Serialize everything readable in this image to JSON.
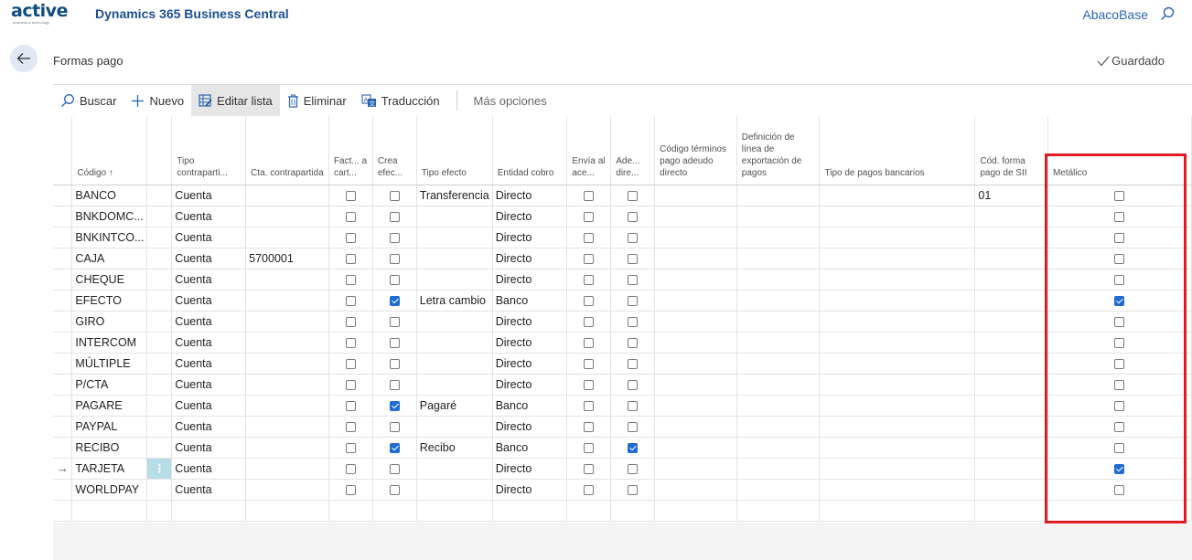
{
  "app": {
    "logo_text": "active",
    "logo_tagline": "business & technology",
    "title": "Dynamics 365 Business Central",
    "company": "AbacoBase"
  },
  "page": {
    "title": "Formas pago",
    "saved_label": "Guardado"
  },
  "actions": [
    {
      "label": "Buscar",
      "icon": "search-icon"
    },
    {
      "label": "Nuevo",
      "icon": "plus-icon"
    },
    {
      "label": "Editar lista",
      "icon": "edit-list-icon",
      "active": true
    },
    {
      "label": "Eliminar",
      "icon": "trash-icon"
    },
    {
      "label": "Traducción",
      "icon": "translate-icon"
    },
    {
      "label": "Más opciones"
    }
  ],
  "columns": {
    "codigo": "Código ↑",
    "tipo_contrapartida": "Tipo contraparti...",
    "cta_contrapartida": "Cta. contrapartida",
    "fact_cartera": "Fact... a cart...",
    "crea_efectos": "Crea efec...",
    "tipo_efecto": "Tipo efecto",
    "entidad_cobro": "Entidad cobro",
    "envia_aceptacion": "Envía al ace...",
    "adeudo_directo": "Ade... dire...",
    "codigo_terminos": "Código términos pago adeudo directo",
    "definicion_linea": "Definición de línea de exportación de pagos",
    "tipo_pagos_bancarios": "Tipo de pagos bancarios",
    "cod_forma_sii": "Cód. forma pago de SII",
    "metalico": "Metálico"
  },
  "rows": [
    {
      "codigo": "BANCO",
      "tipo": "Cuenta",
      "cta": "",
      "fact": false,
      "crea": false,
      "tipo_efecto": "Transferencia",
      "entidad": "Directo",
      "envia": false,
      "adeudo": false,
      "sii": "01",
      "metalico": false
    },
    {
      "codigo": "BNKDOMC...",
      "tipo": "Cuenta",
      "cta": "",
      "fact": false,
      "crea": false,
      "tipo_efecto": "",
      "entidad": "Directo",
      "envia": false,
      "adeudo": false,
      "sii": "",
      "metalico": false
    },
    {
      "codigo": "BNKINTCO...",
      "tipo": "Cuenta",
      "cta": "",
      "fact": false,
      "crea": false,
      "tipo_efecto": "",
      "entidad": "Directo",
      "envia": false,
      "adeudo": false,
      "sii": "",
      "metalico": false
    },
    {
      "codigo": "CAJA",
      "tipo": "Cuenta",
      "cta": "5700001",
      "fact": false,
      "crea": false,
      "tipo_efecto": "",
      "entidad": "Directo",
      "envia": false,
      "adeudo": false,
      "sii": "",
      "metalico": false
    },
    {
      "codigo": "CHEQUE",
      "tipo": "Cuenta",
      "cta": "",
      "fact": false,
      "crea": false,
      "tipo_efecto": "",
      "entidad": "Directo",
      "envia": false,
      "adeudo": false,
      "sii": "",
      "metalico": false
    },
    {
      "codigo": "EFECTO",
      "tipo": "Cuenta",
      "cta": "",
      "fact": false,
      "crea": true,
      "tipo_efecto": "Letra cambio",
      "entidad": "Banco",
      "envia": false,
      "adeudo": false,
      "sii": "",
      "metalico": true
    },
    {
      "codigo": "GIRO",
      "tipo": "Cuenta",
      "cta": "",
      "fact": false,
      "crea": false,
      "tipo_efecto": "",
      "entidad": "Directo",
      "envia": false,
      "adeudo": false,
      "sii": "",
      "metalico": false
    },
    {
      "codigo": "INTERCOM",
      "tipo": "Cuenta",
      "cta": "",
      "fact": false,
      "crea": false,
      "tipo_efecto": "",
      "entidad": "Directo",
      "envia": false,
      "adeudo": false,
      "sii": "",
      "metalico": false
    },
    {
      "codigo": "MÚLTIPLE",
      "tipo": "Cuenta",
      "cta": "",
      "fact": false,
      "crea": false,
      "tipo_efecto": "",
      "entidad": "Directo",
      "envia": false,
      "adeudo": false,
      "sii": "",
      "metalico": false
    },
    {
      "codigo": "P/CTA",
      "tipo": "Cuenta",
      "cta": "",
      "fact": false,
      "crea": false,
      "tipo_efecto": "",
      "entidad": "Directo",
      "envia": false,
      "adeudo": false,
      "sii": "",
      "metalico": false
    },
    {
      "codigo": "PAGARE",
      "tipo": "Cuenta",
      "cta": "",
      "fact": false,
      "crea": true,
      "tipo_efecto": "Pagaré",
      "entidad": "Banco",
      "envia": false,
      "adeudo": false,
      "sii": "",
      "metalico": false
    },
    {
      "codigo": "PAYPAL",
      "tipo": "Cuenta",
      "cta": "",
      "fact": false,
      "crea": false,
      "tipo_efecto": "",
      "entidad": "Directo",
      "envia": false,
      "adeudo": false,
      "sii": "",
      "metalico": false
    },
    {
      "codigo": "RECIBO",
      "tipo": "Cuenta",
      "cta": "",
      "fact": false,
      "crea": true,
      "tipo_efecto": "Recibo",
      "entidad": "Banco",
      "envia": false,
      "adeudo": true,
      "sii": "",
      "metalico": false
    },
    {
      "codigo": "TARJETA",
      "tipo": "Cuenta",
      "cta": "",
      "fact": false,
      "crea": false,
      "tipo_efecto": "",
      "entidad": "Directo",
      "envia": false,
      "adeudo": false,
      "sii": "",
      "metalico": true,
      "selected": true
    },
    {
      "codigo": "WORLDPAY",
      "tipo": "Cuenta",
      "cta": "",
      "fact": false,
      "crea": false,
      "tipo_efecto": "",
      "entidad": "Directo",
      "envia": false,
      "adeudo": false,
      "sii": "",
      "metalico": false
    }
  ],
  "highlight_color": "#e31b23",
  "accent_color": "#1f6bd1"
}
